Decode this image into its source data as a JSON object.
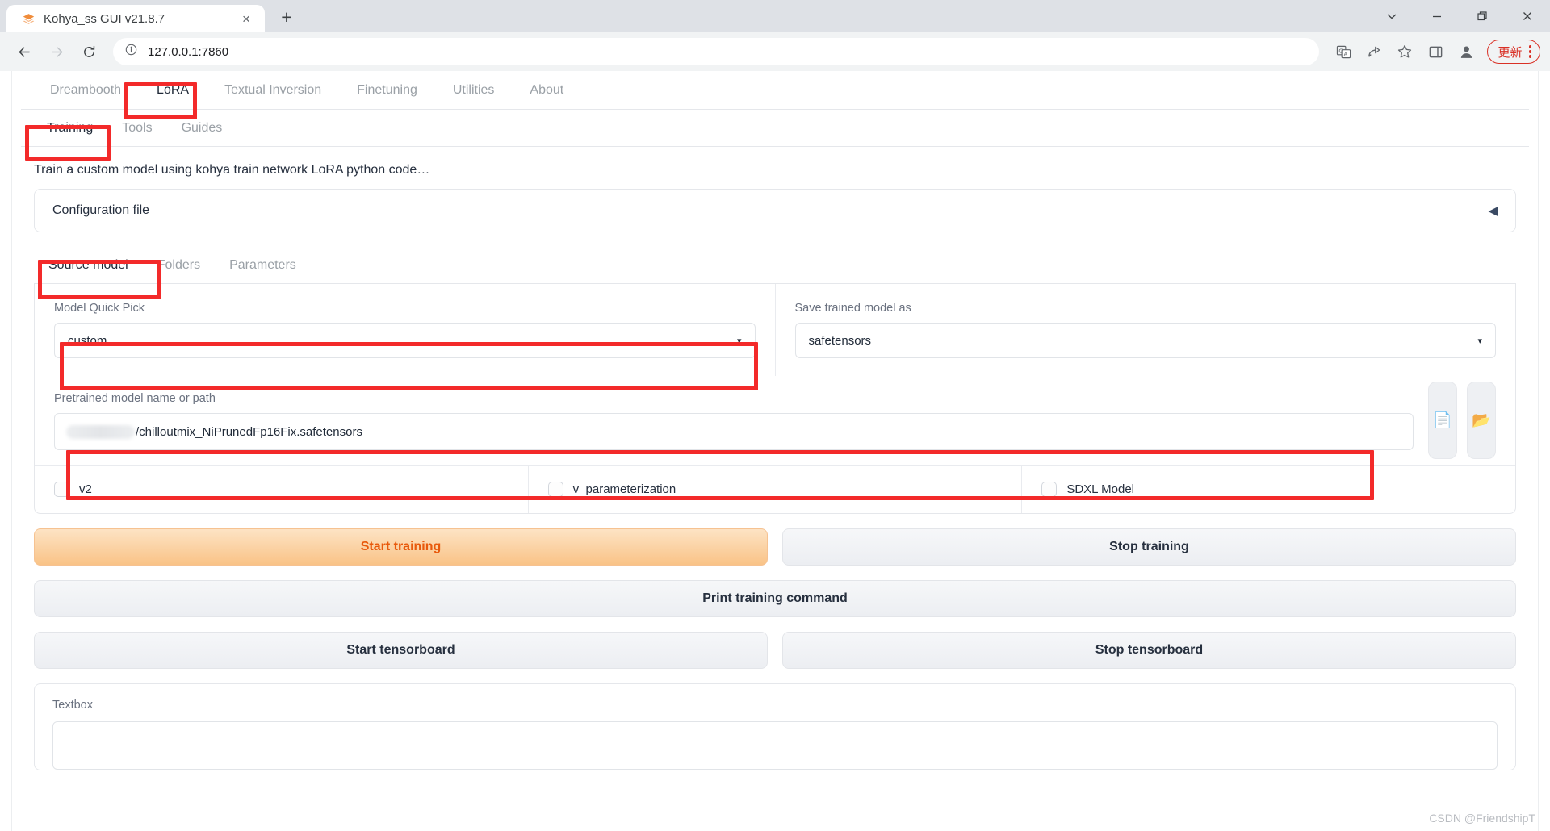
{
  "browser": {
    "tab": {
      "title": "Kohya_ss GUI v21.8.7",
      "favicon": "layers-icon",
      "close": "×"
    },
    "new_tab_label": "+",
    "window_controls": [
      {
        "name": "chevron-down-icon",
        "glyph": "⌄"
      },
      {
        "name": "minimize-icon",
        "glyph": "–"
      },
      {
        "name": "restore-icon",
        "glyph": "❐"
      },
      {
        "name": "close-icon",
        "glyph": "✕"
      }
    ],
    "nav": {
      "back": "←",
      "forward": "→",
      "reload": "⟳"
    },
    "omnibox": {
      "info_icon": "info-circle-icon",
      "url": "127.0.0.1:7860"
    },
    "toolbar_icons": [
      {
        "name": "translate-icon",
        "glyph": "文"
      },
      {
        "name": "share-icon",
        "glyph": "⤴"
      },
      {
        "name": "bookmark-star-icon",
        "glyph": "☆"
      },
      {
        "name": "side-panel-icon",
        "glyph": "▢"
      },
      {
        "name": "profile-avatar-icon",
        "glyph": "●"
      }
    ],
    "update_button": {
      "label": "更新",
      "menu": "kebab-menu-icon"
    }
  },
  "app": {
    "main_tabs": [
      {
        "label": "Dreambooth",
        "active": false
      },
      {
        "label": "LoRA",
        "active": true
      },
      {
        "label": "Textual Inversion",
        "active": false
      },
      {
        "label": "Finetuning",
        "active": false
      },
      {
        "label": "Utilities",
        "active": false
      },
      {
        "label": "About",
        "active": false
      }
    ],
    "sub_tabs": [
      {
        "label": "Training",
        "active": true
      },
      {
        "label": "Tools",
        "active": false
      },
      {
        "label": "Guides",
        "active": false
      }
    ],
    "description": "Train a custom model using kohya train network LoRA python code…",
    "configuration_accordion": {
      "label": "Configuration file",
      "arrow": "◀"
    },
    "section_tabs": [
      {
        "label": "Source model",
        "active": true
      },
      {
        "label": "Folders",
        "active": false
      },
      {
        "label": "Parameters",
        "active": false
      }
    ],
    "model_quick_pick": {
      "label": "Model Quick Pick",
      "value": "custom",
      "caret": "▾"
    },
    "save_trained_model_as": {
      "label": "Save trained model as",
      "value": "safetensors",
      "caret": "▾"
    },
    "pretrained_model": {
      "label": "Pretrained model name or path",
      "redacted_prefix": true,
      "value": "/chilloutmix_NiPrunedFp16Fix.safetensors"
    },
    "file_buttons": [
      {
        "name": "document-icon",
        "glyph": "📄"
      },
      {
        "name": "folder-icon",
        "glyph": "📂"
      }
    ],
    "checkboxes": [
      {
        "label": "v2",
        "checked": false
      },
      {
        "label": "v_parameterization",
        "checked": false
      },
      {
        "label": "SDXL Model",
        "checked": false
      }
    ],
    "buttons": {
      "start_training": "Start training",
      "stop_training": "Stop training",
      "print_training_command": "Print training command",
      "start_tensorboard": "Start tensorboard",
      "stop_tensorboard": "Stop tensorboard"
    },
    "textbox": {
      "label": "Textbox",
      "value": ""
    }
  },
  "watermark": "CSDN @FriendshipT",
  "colors": {
    "annotation": "#f32a2a",
    "primary_button_text": "#e8590c",
    "update_red": "#d93025"
  }
}
